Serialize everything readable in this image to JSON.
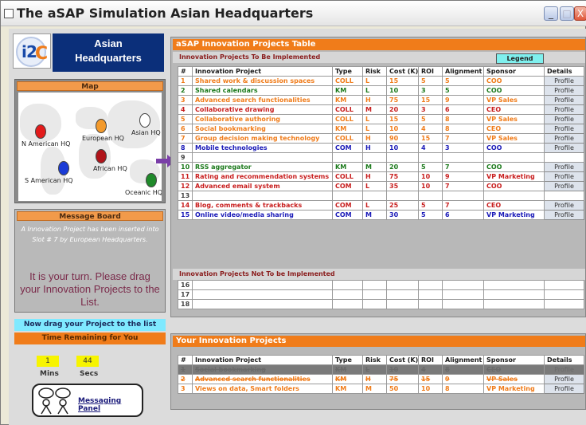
{
  "window": {
    "title": "The aSAP Simulation Asian Headquarters",
    "buttons": [
      "_",
      "□",
      "X"
    ]
  },
  "header": {
    "logo_text": "i2C",
    "hq_name_line1": "Asian",
    "hq_name_line2": "Headquarters"
  },
  "map": {
    "heading": "Map",
    "markers": [
      {
        "label": "N American HQ",
        "color": "#e31b1b"
      },
      {
        "label": "European HQ",
        "color": "#f39a2c"
      },
      {
        "label": "Asian HQ",
        "color": "#ffffff"
      },
      {
        "label": "African HQ",
        "color": "#b0141a"
      },
      {
        "label": "S American HQ",
        "color": "#1a3bd6"
      },
      {
        "label": "Oceanic HQ",
        "color": "#1f8a2a"
      }
    ]
  },
  "message_board": {
    "heading": "Message Board",
    "message": "A Innovation Project has been inserted into Slot # 7 by European Headquarters.",
    "turn_message": "It is your turn. Please drag your Innovation Projects to the List."
  },
  "drag_banner": "Now drag your Project to the list",
  "time": {
    "banner": "Time Remaining for You",
    "mins_value": "1",
    "secs_value": "44",
    "mins_label": "Mins",
    "secs_label": "Secs"
  },
  "messaging_panel": "Messaging Panel",
  "projects_table": {
    "title": "aSAP Innovation Projects Table",
    "subtitle": "Innovation Projects To Be Implemented",
    "legend_label": "Legend",
    "columns": [
      "#",
      "Innovation Project",
      "Type",
      "Risk",
      "Cost (K)",
      "ROI",
      "Alignment",
      "Sponsor",
      "Details"
    ],
    "rows": [
      {
        "num": "1",
        "project": "Shared work & discussion spaces",
        "type": "COLL",
        "risk": "L",
        "cost": "15",
        "roi": "5",
        "alignment": "5",
        "sponsor": "COO",
        "details": "Profile",
        "color": "orange"
      },
      {
        "num": "2",
        "project": "Shared calendars",
        "type": "KM",
        "risk": "L",
        "cost": "10",
        "roi": "3",
        "alignment": "5",
        "sponsor": "COO",
        "details": "Profile",
        "color": "green"
      },
      {
        "num": "3",
        "project": "Advanced search functionalities",
        "type": "KM",
        "risk": "H",
        "cost": "75",
        "roi": "15",
        "alignment": "9",
        "sponsor": "VP Sales",
        "details": "Profile",
        "color": "orange"
      },
      {
        "num": "4",
        "project": "Collaborative drawing",
        "type": "COLL",
        "risk": "M",
        "cost": "20",
        "roi": "3",
        "alignment": "6",
        "sponsor": "CEO",
        "details": "Profile",
        "color": "red"
      },
      {
        "num": "5",
        "project": "Collaborative authoring",
        "type": "COLL",
        "risk": "L",
        "cost": "15",
        "roi": "5",
        "alignment": "8",
        "sponsor": "VP Sales",
        "details": "Profile",
        "color": "orange"
      },
      {
        "num": "6",
        "project": "Social bookmarking",
        "type": "KM",
        "risk": "L",
        "cost": "10",
        "roi": "4",
        "alignment": "8",
        "sponsor": "CEO",
        "details": "Profile",
        "color": "orange"
      },
      {
        "num": "7",
        "project": "Group decision making technology",
        "type": "COLL",
        "risk": "H",
        "cost": "90",
        "roi": "15",
        "alignment": "7",
        "sponsor": "VP Sales",
        "details": "Profile",
        "color": "orange"
      },
      {
        "num": "8",
        "project": "Mobile technologies",
        "type": "COM",
        "risk": "H",
        "cost": "10",
        "roi": "4",
        "alignment": "3",
        "sponsor": "COO",
        "details": "Profile",
        "color": "blue"
      },
      {
        "num": "9",
        "project": "",
        "type": "",
        "risk": "",
        "cost": "",
        "roi": "",
        "alignment": "",
        "sponsor": "",
        "details": "",
        "color": "muted"
      },
      {
        "num": "10",
        "project": "RSS aggregator",
        "type": "KM",
        "risk": "M",
        "cost": "20",
        "roi": "5",
        "alignment": "7",
        "sponsor": "COO",
        "details": "Profile",
        "color": "green"
      },
      {
        "num": "11",
        "project": "Rating and recommendation systems",
        "type": "COLL",
        "risk": "H",
        "cost": "75",
        "roi": "10",
        "alignment": "9",
        "sponsor": "VP Marketing",
        "details": "Profile",
        "color": "red"
      },
      {
        "num": "12",
        "project": "Advanced email system",
        "type": "COM",
        "risk": "L",
        "cost": "35",
        "roi": "10",
        "alignment": "7",
        "sponsor": "COO",
        "details": "Profile",
        "color": "red"
      },
      {
        "num": "13",
        "project": "",
        "type": "",
        "risk": "",
        "cost": "",
        "roi": "",
        "alignment": "",
        "sponsor": "",
        "details": "",
        "color": "muted"
      },
      {
        "num": "14",
        "project": "Blog, comments & trackbacks",
        "type": "COM",
        "risk": "L",
        "cost": "25",
        "roi": "5",
        "alignment": "7",
        "sponsor": "CEO",
        "details": "Profile",
        "color": "red"
      },
      {
        "num": "15",
        "project": "Online video/media sharing",
        "type": "COM",
        "risk": "M",
        "cost": "30",
        "roi": "5",
        "alignment": "6",
        "sponsor": "VP Marketing",
        "details": "Profile",
        "color": "blue"
      }
    ],
    "not_implemented_label": "Innovation Projects Not To be Implemented",
    "not_implemented_rows": [
      "16",
      "17",
      "18"
    ]
  },
  "your_projects": {
    "title": "Your Innovation Projects",
    "columns": [
      "#",
      "Innovation Project",
      "Type",
      "Risk",
      "Cost (K)",
      "ROI",
      "Alignment",
      "Sponsor",
      "Details"
    ],
    "rows": [
      {
        "num": "1",
        "project": "Social bookmarking",
        "type": "KM",
        "risk": "L",
        "cost": "10",
        "roi": "4",
        "alignment": "8",
        "sponsor": "CEO",
        "details": "Profile",
        "state": "selected"
      },
      {
        "num": "2",
        "project": "Advanced search functionalities",
        "type": "KM",
        "risk": "H",
        "cost": "75",
        "roi": "15",
        "alignment": "9",
        "sponsor": "VP Sales",
        "details": "Profile",
        "state": "used"
      },
      {
        "num": "3",
        "project": "Views on data, Smart folders",
        "type": "KM",
        "risk": "M",
        "cost": "50",
        "roi": "10",
        "alignment": "8",
        "sponsor": "VP Marketing",
        "details": "Profile",
        "state": "normal"
      }
    ]
  }
}
